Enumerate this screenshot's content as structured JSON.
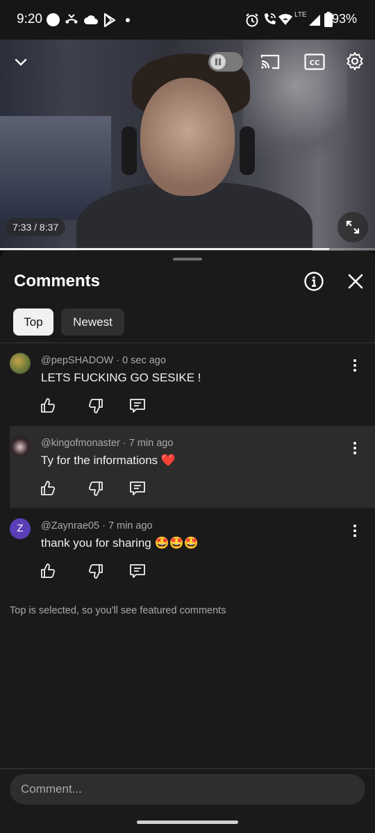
{
  "status_bar": {
    "time": "9:20",
    "battery": "93%",
    "network": "LTE",
    "icons": [
      "circle-icon",
      "missed-call-icon",
      "cloud-icon",
      "play-store-icon",
      "dot-icon",
      "alarm-icon",
      "wifi-call-icon",
      "wifi-icon",
      "signal-icon",
      "battery-icon"
    ]
  },
  "video": {
    "time_display": "7:33 / 8:37",
    "progress": 0.877,
    "icons": [
      "chevron-down-icon",
      "pause-icon",
      "cast-icon",
      "cc-icon",
      "gear-icon",
      "fullscreen-icon"
    ]
  },
  "comments_panel": {
    "title": "Comments",
    "tabs": [
      {
        "label": "Top",
        "selected": true
      },
      {
        "label": "Newest",
        "selected": false
      }
    ],
    "comments": [
      {
        "author": "@pepSHADOW",
        "time": "0 sec ago",
        "text": "LETS FUCKING GO SESIKE !",
        "highlighted": false,
        "avatar_letter": "",
        "avatar_color": "#6b7b3a"
      },
      {
        "author": "@kingofmonaster",
        "time": "7 min ago",
        "text": "Ty for the informations ❤️",
        "highlighted": true,
        "avatar_letter": "",
        "avatar_color": "#3a2a30"
      },
      {
        "author": "@Zaynrae05",
        "time": "7 min ago",
        "text": "thank you for sharing 🤩🤩🤩",
        "highlighted": false,
        "avatar_letter": "Z",
        "avatar_color": "#5a3fb8"
      }
    ],
    "footer_note": "Top is selected, so you'll see featured comments",
    "input_placeholder": "Comment..."
  }
}
